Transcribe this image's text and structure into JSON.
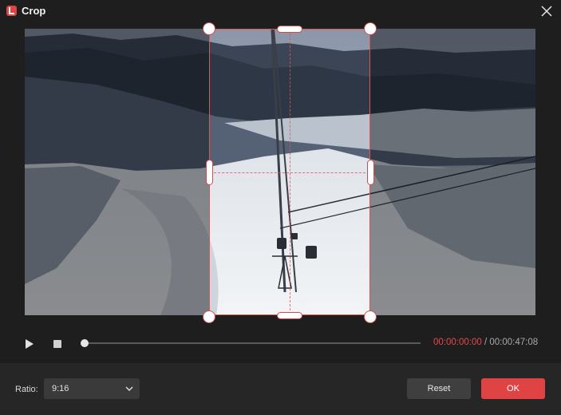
{
  "window": {
    "title": "Crop",
    "accent_color": "#e04343"
  },
  "icons": {
    "app": "crop-app-icon",
    "close": "close-icon",
    "play": "play-icon",
    "stop": "stop-icon",
    "dropdown": "chevron-down-icon"
  },
  "player": {
    "current_time": "00:00:00:00",
    "separator": " / ",
    "total_time": "00:00:47:08",
    "progress": 0.0
  },
  "footer": {
    "ratio_label": "Ratio:",
    "ratio_value": "9:16",
    "reset_label": "Reset",
    "ok_label": "OK"
  }
}
